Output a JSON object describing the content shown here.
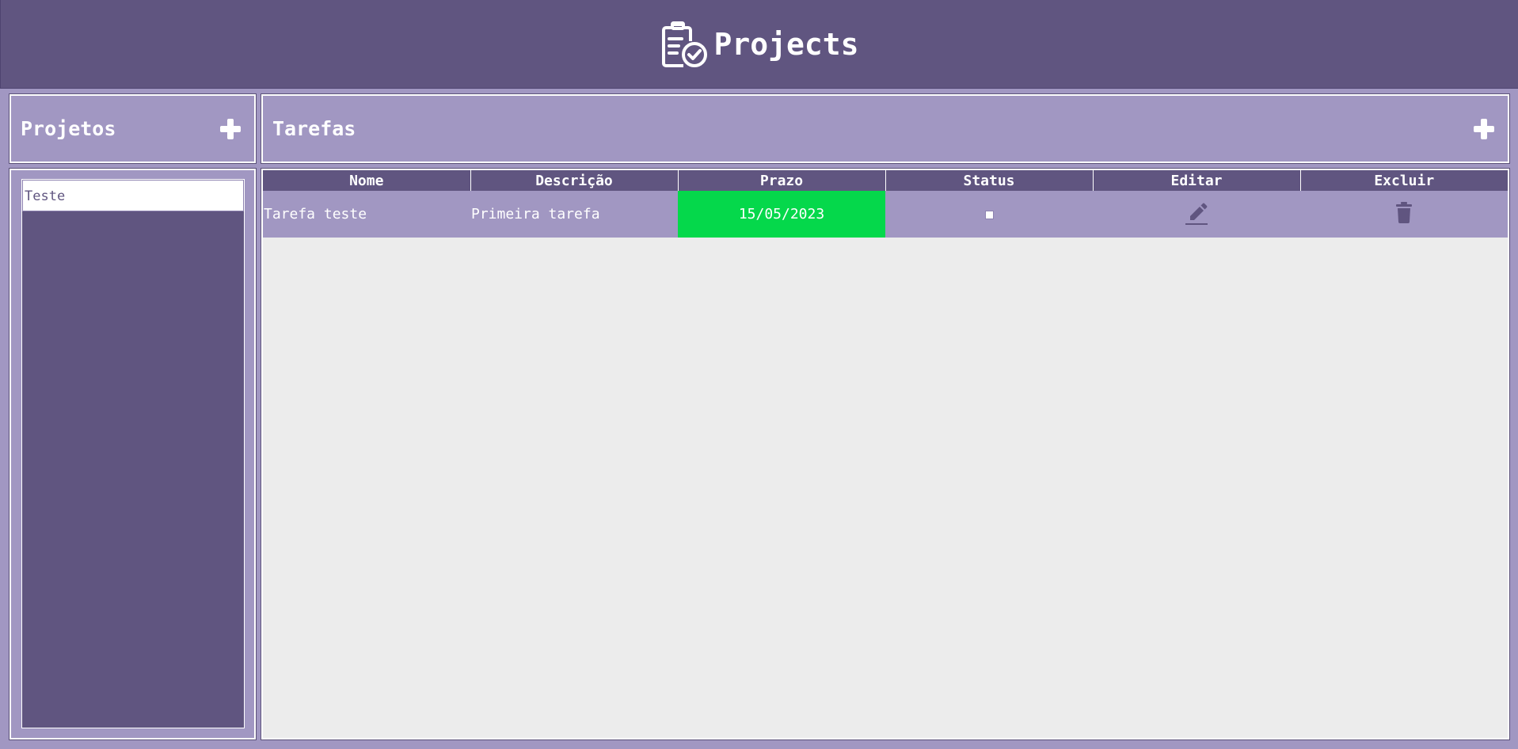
{
  "app": {
    "title": "Projects",
    "logo_icon": "clipboard-check-icon"
  },
  "colors": {
    "primary": "#605580",
    "secondary": "#a197c2",
    "due_ok": "#05d84b",
    "content_bg": "#ececec"
  },
  "projects_panel": {
    "title": "Projetos",
    "add_icon": "plus-icon",
    "items": [
      {
        "label": "Teste",
        "selected": true
      }
    ]
  },
  "tasks_panel": {
    "title": "Tarefas",
    "add_icon": "plus-icon",
    "columns": [
      "Nome",
      "Descrição",
      "Prazo",
      "Status",
      "Editar",
      "Excluir"
    ],
    "rows": [
      {
        "name": "Tarefa teste",
        "description": "Primeira tarefa",
        "due": "15/05/2023",
        "status_checked": false,
        "edit_icon": "pencil-icon",
        "delete_icon": "trash-icon"
      }
    ]
  }
}
